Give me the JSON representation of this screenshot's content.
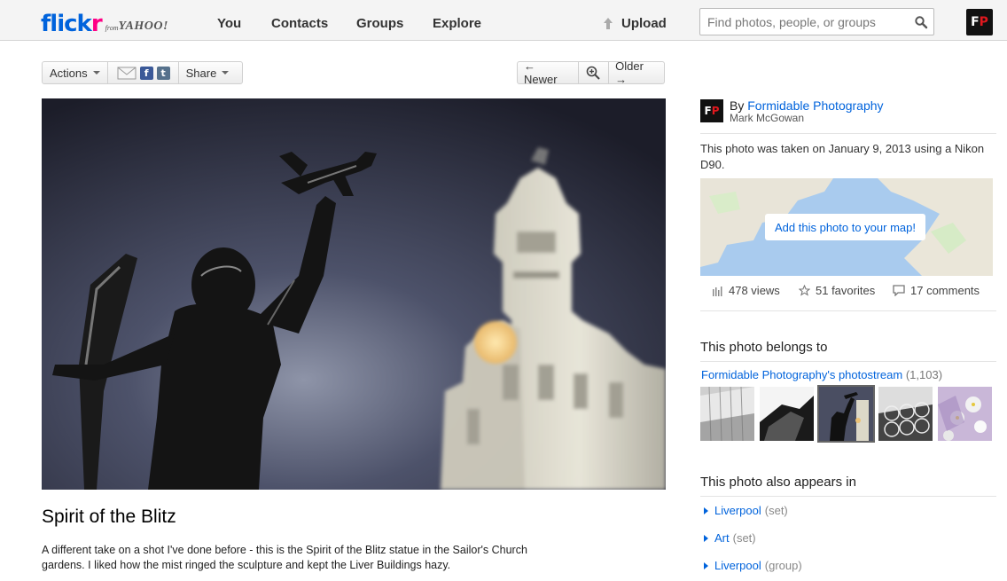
{
  "brand": {
    "logo_part1": "flick",
    "logo_part2": "r",
    "logo_from": "from",
    "logo_yahoo": "YAHOO!",
    "logo_color_blue": "#0063dc",
    "logo_color_pink": "#ff0084"
  },
  "nav": {
    "items": [
      "You",
      "Contacts",
      "Groups",
      "Explore"
    ],
    "upload_label": "Upload",
    "search_placeholder": "Find photos, people, or groups",
    "avatar_text_1": "F",
    "avatar_text_2": "P"
  },
  "toolbar": {
    "actions_label": "Actions",
    "share_label": "Share",
    "facebook_icon": "f",
    "tumblr_icon": "t",
    "newer_label": "← Newer",
    "older_label": "Older →"
  },
  "photo": {
    "title": "Spirit of the Blitz",
    "description": "A different take on a shot I've done before - this is the Spirit of the Blitz statue in the Sailor's Church gardens. I liked how the mist ringed the sculpture and kept the Liver Buildings hazy."
  },
  "sidebar": {
    "by_label": "By",
    "owner_name": "Formidable Photography",
    "owner_real_name": "Mark McGowan",
    "taken_text": "This photo was taken on January 9, 2013 using a Nikon D90.",
    "map_button": "Add this photo to your map!",
    "views": "478 views",
    "favorites": "51 favorites",
    "comments": "17 comments",
    "belongs_heading": "This photo belongs to",
    "stream_link": "Formidable Photography's photostream",
    "stream_count": "(1,103)",
    "appears_heading": "This photo also appears in",
    "sets": [
      {
        "name": "Liverpool",
        "kind": "(set)"
      },
      {
        "name": "Art",
        "kind": "(set)"
      },
      {
        "name": "Liverpool",
        "kind": "(group)"
      }
    ]
  }
}
